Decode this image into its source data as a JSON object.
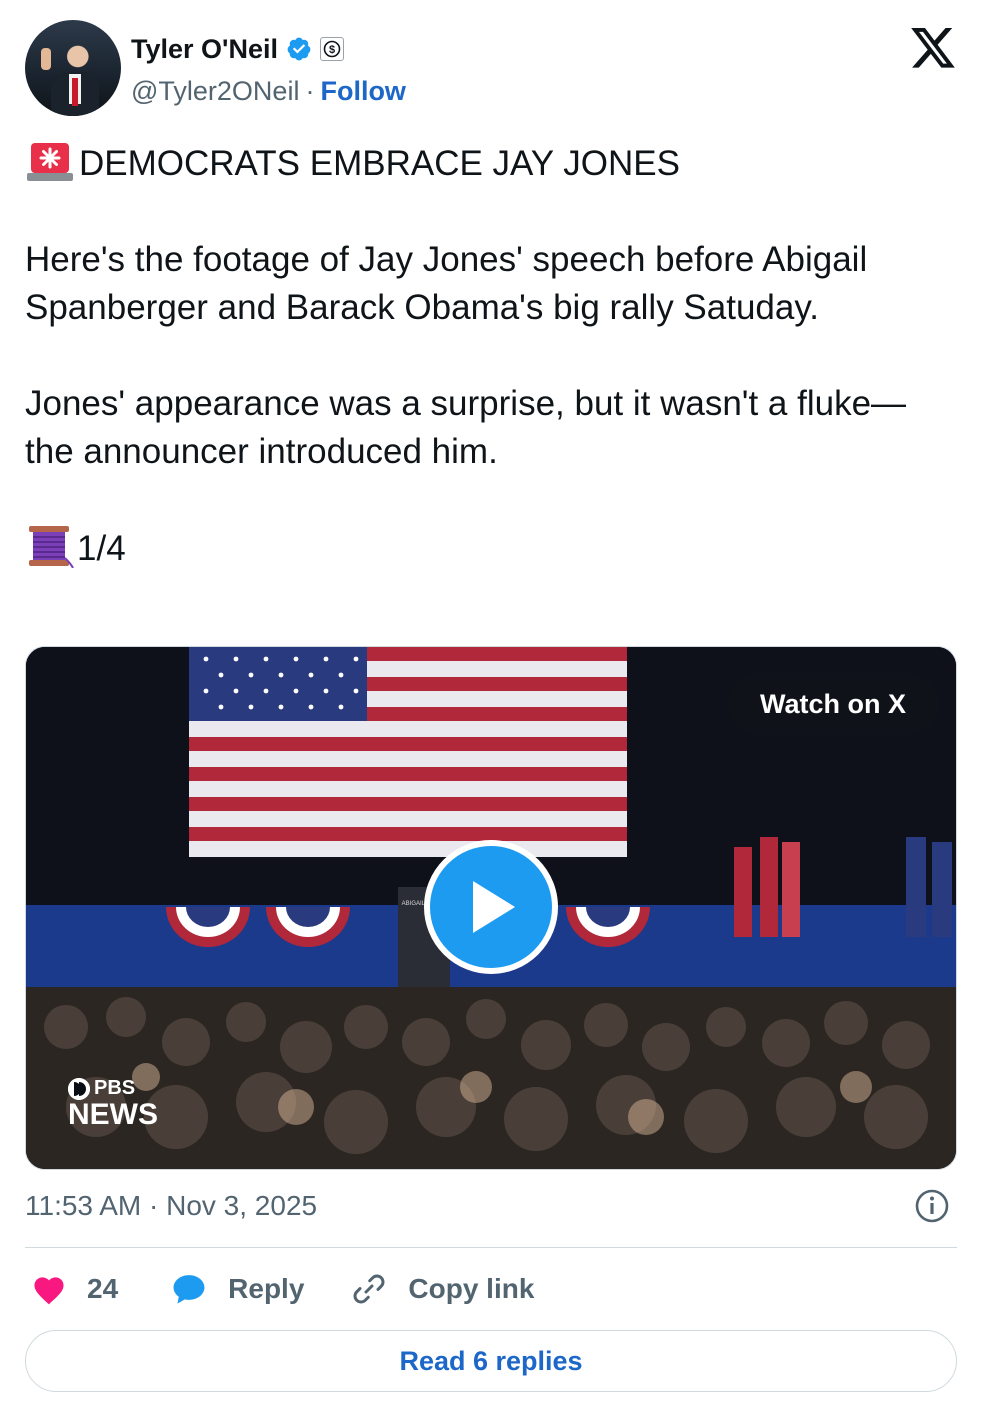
{
  "author": {
    "name": "Tyler O'Neil",
    "handle": "@Tyler2ONeil",
    "separator": "·",
    "follow_label": "Follow"
  },
  "icons": {
    "verified": "verified-badge-icon",
    "subscription": "dollar-badge-icon",
    "platform": "x-logo-icon",
    "siren": "police-light-emoji",
    "thread": "spool-of-thread-emoji",
    "like": "heart-icon",
    "reply": "speech-bubble-icon",
    "copy": "link-icon",
    "info": "info-icon",
    "play": "play-icon"
  },
  "tweet": {
    "headline": "DEMOCRATS EMBRACE JAY JONES",
    "paragraph1": "Here's the footage of Jay Jones' speech before Abigail Spanberger and Barack Obama's big rally Satuday.",
    "paragraph2": "Jones' appearance was a surprise, but it wasn't a fluke—the announcer introduced him.",
    "thread_count": "1/4"
  },
  "media": {
    "watch_label": "Watch on X",
    "watermark_top": "PBS",
    "watermark_bottom": "NEWS",
    "podium_text": "ABIGAIL SPANB"
  },
  "meta": {
    "timestamp": "11:53 AM · Nov 3, 2025"
  },
  "actions": {
    "like_count": "24",
    "reply_label": "Reply",
    "copy_label": "Copy link",
    "read_replies_label": "Read 6 replies"
  },
  "colors": {
    "link_blue": "#1d67c9",
    "verified_blue": "#1d9bf0",
    "like_pink": "#f91880",
    "secondary_text": "#536471"
  }
}
